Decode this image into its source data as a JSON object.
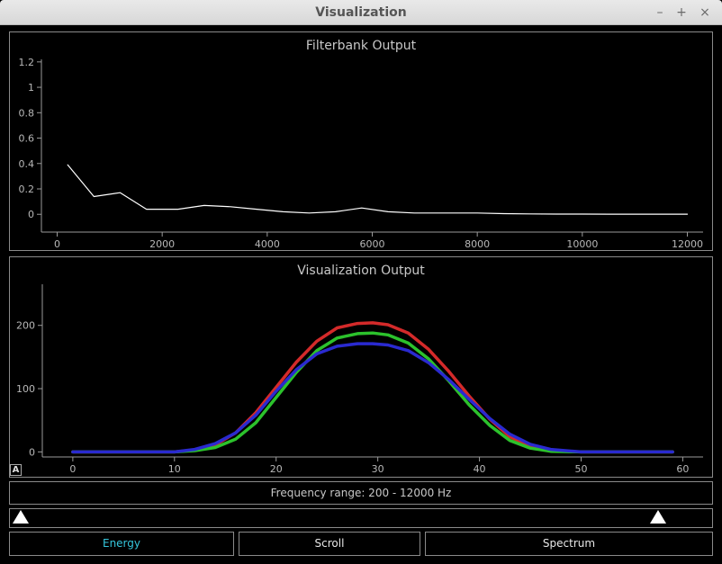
{
  "window": {
    "title": "Visualization",
    "controls": {
      "minimize": "–",
      "maximize": "+",
      "close": "×"
    }
  },
  "colors": {
    "accent_active": "#35c6dc",
    "series_red": "#d42a2a",
    "series_green": "#2cc22c",
    "series_blue": "#2a2ad0"
  },
  "auto_scale_label": "A",
  "frequency_range_label": "Frequency range: 200 - 12000 Hz",
  "frequency_range": {
    "min_hz": 200,
    "max_hz": 12000
  },
  "buttons": {
    "energy": "Energy",
    "scroll": "Scroll",
    "spectrum": "Spectrum"
  },
  "chart_data": [
    {
      "type": "line",
      "title": "Filterbank Output",
      "xlim": [
        -300,
        12300
      ],
      "ylim": [
        -0.14,
        1.22
      ],
      "xticks": [
        0,
        2000,
        4000,
        6000,
        8000,
        10000,
        12000
      ],
      "xtick_labels": [
        "0",
        "2000",
        "4000",
        "6000",
        "8000",
        "10000",
        "12000"
      ],
      "yticks": [
        0,
        0.2,
        0.4,
        0.6,
        0.8,
        1,
        1.2
      ],
      "ytick_labels": [
        "0",
        "0.2",
        "0.4",
        "0.6",
        "0.8",
        "1",
        "1.2"
      ],
      "grid": false,
      "series": [
        {
          "color": "#ffffff",
          "x": [
            200,
            700,
            1200,
            1700,
            2300,
            2800,
            3300,
            3800,
            4300,
            4800,
            5300,
            5800,
            6300,
            6800,
            7400,
            8000,
            8500,
            9000,
            9500,
            10000,
            10500,
            11000,
            11500,
            12000
          ],
          "y": [
            0.39,
            0.14,
            0.17,
            0.04,
            0.04,
            0.07,
            0.06,
            0.04,
            0.02,
            0.01,
            0.02,
            0.05,
            0.02,
            0.01,
            0.01,
            0.01,
            0.005,
            0.003,
            0.002,
            0.002,
            0.001,
            0.001,
            0.001,
            0.001
          ]
        }
      ]
    },
    {
      "type": "line",
      "title": "Visualization Output",
      "xlim": [
        -3,
        62
      ],
      "ylim": [
        -8,
        265
      ],
      "xticks": [
        0,
        10,
        20,
        30,
        40,
        50,
        60
      ],
      "xtick_labels": [
        "0",
        "10",
        "20",
        "30",
        "40",
        "50",
        "60"
      ],
      "yticks": [
        0,
        100,
        200
      ],
      "ytick_labels": [
        "0",
        "100",
        "200"
      ],
      "grid": false,
      "series": [
        {
          "color": "#d42a2a",
          "x": [
            0,
            5,
            10,
            12,
            14,
            16,
            18,
            20,
            22,
            24,
            26,
            28,
            29.5,
            31,
            33,
            35,
            37,
            39,
            41,
            43,
            45,
            47,
            50,
            55,
            59
          ],
          "y": [
            0,
            0,
            0,
            3,
            11,
            30,
            62,
            102,
            142,
            175,
            196,
            203,
            204,
            201,
            188,
            162,
            127,
            88,
            52,
            24,
            9,
            2,
            0,
            0,
            0
          ]
        },
        {
          "color": "#2cc22c",
          "x": [
            0,
            5,
            10,
            12,
            14,
            16,
            18,
            20,
            22,
            24,
            26,
            28,
            29.5,
            31,
            33,
            35,
            37,
            39,
            41,
            43,
            45,
            47,
            50,
            55,
            59
          ],
          "y": [
            0,
            0,
            0,
            2,
            7,
            20,
            46,
            86,
            126,
            160,
            180,
            187,
            188,
            185,
            172,
            147,
            112,
            74,
            42,
            18,
            6,
            1,
            0,
            0,
            0
          ]
        },
        {
          "color": "#2a2ad0",
          "x": [
            0,
            5,
            10,
            12,
            14,
            16,
            18,
            20,
            22,
            24,
            26,
            28,
            29.5,
            31,
            33,
            35,
            37,
            39,
            41,
            43,
            45,
            47,
            50,
            55,
            59
          ],
          "y": [
            0,
            0,
            0,
            4,
            13,
            30,
            58,
            96,
            130,
            155,
            167,
            171,
            171,
            169,
            160,
            141,
            114,
            83,
            53,
            28,
            12,
            4,
            0,
            0,
            0
          ]
        }
      ]
    }
  ]
}
